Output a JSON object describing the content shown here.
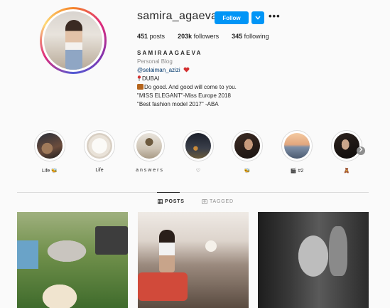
{
  "profile": {
    "username": "samira_agaeva_",
    "follow_label": "Follow",
    "more_label": "•••",
    "stats": {
      "posts_value": "451",
      "posts_label": "posts",
      "followers_value": "203k",
      "followers_label": "followers",
      "following_value": "345",
      "following_label": "following"
    },
    "bio": {
      "name": "SAMIRAAGAEVA",
      "category": "Personal Blog",
      "mention": "@selaiman_azizi",
      "location": "DUBAI",
      "line1": "Do good. And good will come to you.",
      "line2": "\"MISS ELEGANT\"-Miss Europe 2018",
      "line3": "\"Best fashion model 2017\" -ABA"
    }
  },
  "highlights": [
    {
      "label": "Life 🐝"
    },
    {
      "label": "Life"
    },
    {
      "label": "a n s w e r s"
    },
    {
      "label": "♡"
    },
    {
      "label": "🐝"
    },
    {
      "label": "🎬 #2"
    },
    {
      "label": "🧸"
    }
  ],
  "tabs": {
    "posts": "POSTS",
    "tagged": "TAGGED"
  },
  "colors": {
    "accent": "#0095f6",
    "link": "#00376b",
    "muted": "#8e8e8e"
  }
}
